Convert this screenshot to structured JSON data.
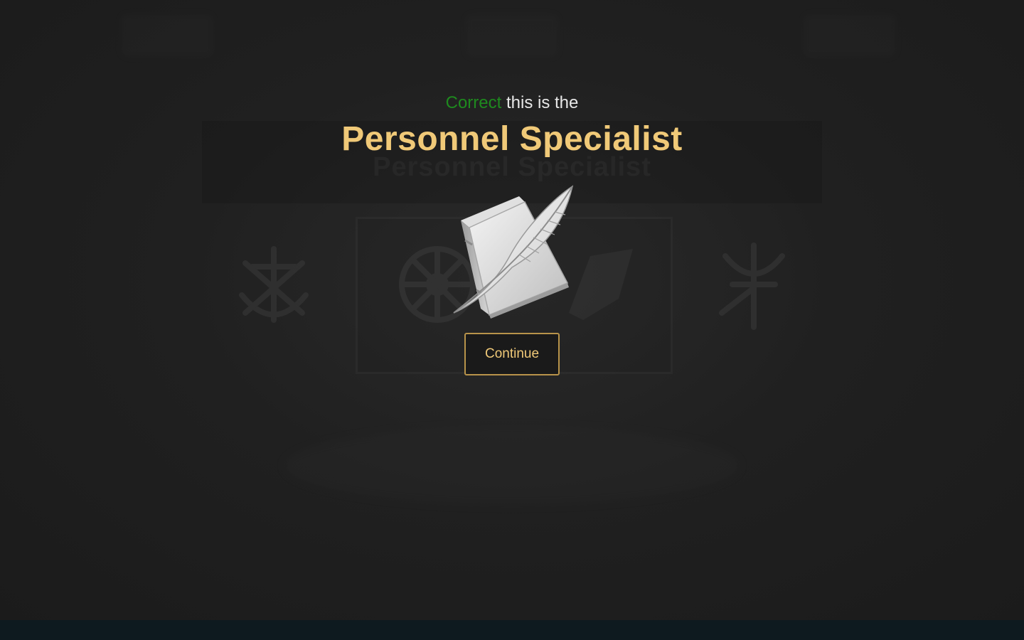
{
  "result": {
    "status_word": "Correct",
    "message": " this is the",
    "status_color": "#1e8a1e"
  },
  "role": {
    "name": "Personnel Specialist",
    "icon": "book-quill-icon",
    "title_color": "#f0c978"
  },
  "background": {
    "banner_text": "Personnel Specialist"
  },
  "actions": {
    "continue_label": "Continue"
  }
}
